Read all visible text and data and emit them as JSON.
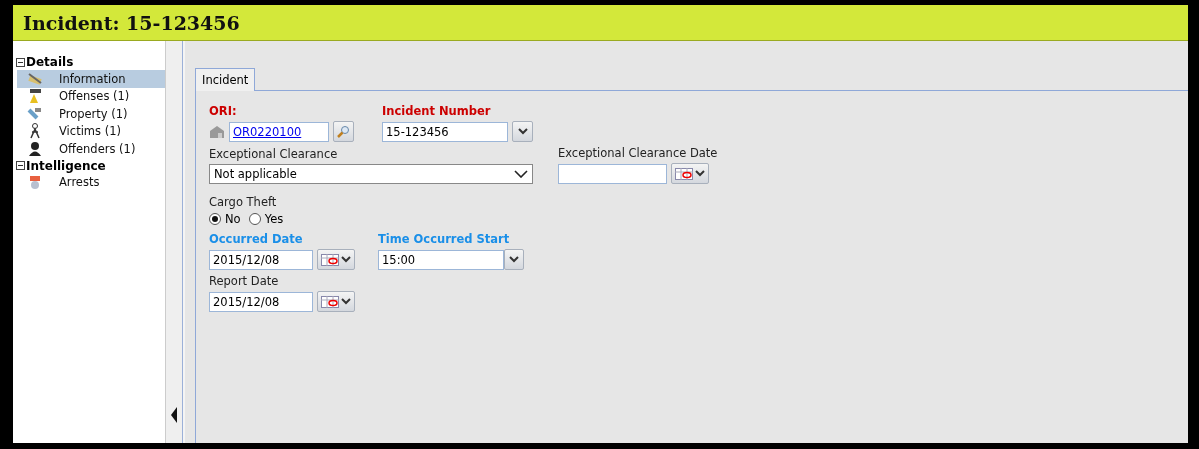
{
  "window": {
    "title": "Incident: 15-123456"
  },
  "sidebar": {
    "groups": [
      {
        "label": "Details",
        "expanded": true,
        "children": [
          {
            "label": "Information",
            "selected": true
          },
          {
            "label": "Offenses (1)",
            "selected": false
          },
          {
            "label": "Property (1)",
            "selected": false
          },
          {
            "label": "Victims (1)",
            "selected": false
          },
          {
            "label": "Offenders (1)",
            "selected": false
          }
        ]
      },
      {
        "label": "Intelligence",
        "expanded": true,
        "children": [
          {
            "label": "Arrests",
            "selected": false
          }
        ]
      }
    ]
  },
  "tabs": [
    {
      "label": "Incident",
      "selected": true
    }
  ],
  "form": {
    "ori": {
      "label": "ORI:",
      "kind": "required",
      "value": "OR0220100"
    },
    "incident_number": {
      "label": "Incident Number",
      "kind": "required",
      "value": "15-123456"
    },
    "exceptional_clearance": {
      "label": "Exceptional Clearance",
      "value": "Not applicable"
    },
    "exceptional_clearance_date": {
      "label": "Exceptional Clearance Date"
    },
    "cargo_theft": {
      "label": "Cargo Theft",
      "options": [
        {
          "label": "No",
          "selected": true
        },
        {
          "label": "Yes",
          "selected": false
        }
      ]
    },
    "occurred_date": {
      "label": "Occurred Date",
      "kind": "important",
      "value": "2015/12/08"
    },
    "time_occurred_start": {
      "label": "Time Occurred Start",
      "kind": "important",
      "value": "15:00"
    },
    "report_date": {
      "label": "Report Date",
      "value": "2015/12/08"
    }
  }
}
